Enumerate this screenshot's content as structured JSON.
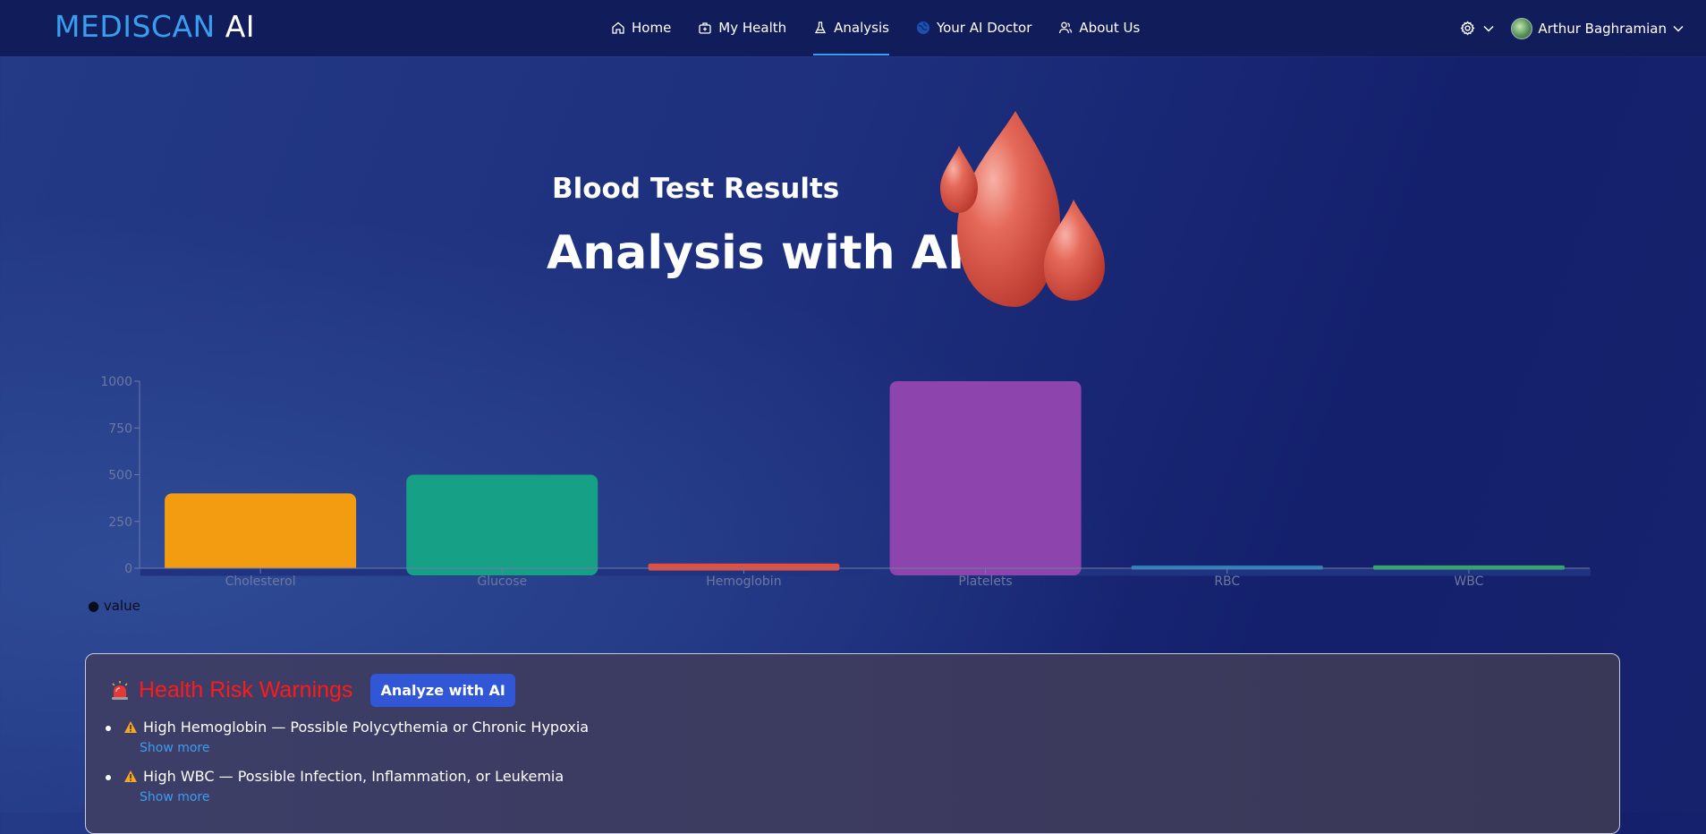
{
  "brand": {
    "part1": "MEDISCAN",
    "part2": "AI"
  },
  "nav": {
    "items": [
      {
        "label": "Home",
        "icon": "home-icon"
      },
      {
        "label": "My Health",
        "icon": "medical-bag-icon"
      },
      {
        "label": "Analysis",
        "icon": "flask-icon",
        "active": true
      },
      {
        "label": "Your AI Doctor",
        "icon": "globe-icon"
      },
      {
        "label": "About Us",
        "icon": "users-icon"
      }
    ],
    "user": "Arthur Baghramian"
  },
  "hero": {
    "subtitle": "Blood Test Results",
    "title": "Analysis with AI"
  },
  "chart_data": {
    "type": "bar",
    "categories": [
      "Cholesterol",
      "Glucose",
      "Hemoglobin",
      "Platelets",
      "RBC",
      "WBC"
    ],
    "values": [
      400,
      500,
      25,
      1000,
      5,
      15
    ],
    "colors": [
      "#f39c12",
      "#16a085",
      "#e74c3c",
      "#8e44ad",
      "#2980b9",
      "#27ae60"
    ],
    "yticks": [
      0,
      250,
      500,
      750,
      1000
    ],
    "ylim": [
      0,
      1000
    ],
    "legend": "value"
  },
  "warnings": {
    "title": "Health Risk Warnings",
    "button": "Analyze with AI",
    "items": [
      {
        "text": "High Hemoglobin — Possible Polycythemia or Chronic Hypoxia",
        "link": "Show more"
      },
      {
        "text": "High WBC — Possible Infection, Inflammation, or Leukemia",
        "link": "Show more"
      }
    ]
  }
}
